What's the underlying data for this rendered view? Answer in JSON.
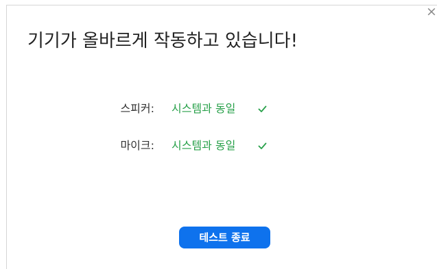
{
  "dialog": {
    "title": "기기가 올바르게 작동하고 있습니다!",
    "close_icon": "close-icon",
    "devices": [
      {
        "label": "스피커:",
        "value": "시스템과 동일",
        "status_icon": "checkmark-icon"
      },
      {
        "label": "마이크:",
        "value": "시스템과 동일",
        "status_icon": "checkmark-icon"
      }
    ],
    "end_button_label": "테스트 종료"
  },
  "colors": {
    "accent": "#0e72ed",
    "success": "#27a049",
    "title_text": "#222222",
    "label_text": "#333333"
  }
}
